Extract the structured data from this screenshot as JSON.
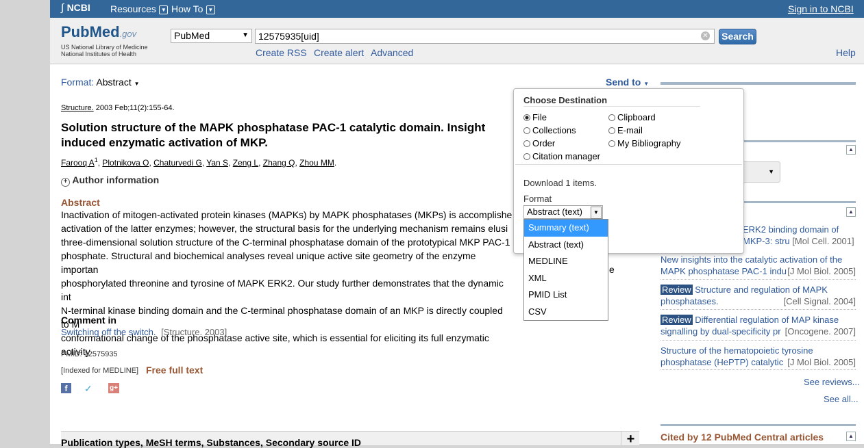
{
  "topbar": {
    "ncbi": "NCBI",
    "resources": "Resources",
    "howto": "How To",
    "signin": "Sign in to NCBI"
  },
  "header": {
    "logo_pub": "Pub",
    "logo_med": "Med",
    "logo_gov": ".gov",
    "logo_sub1": "US National Library of Medicine",
    "logo_sub2": "National Institutes of Health",
    "db_select": "PubMed",
    "search_value": "12575935[uid]",
    "search_button": "Search",
    "create_rss": "Create RSS",
    "create_alert": "Create alert",
    "advanced": "Advanced",
    "help": "Help"
  },
  "toolbar": {
    "format_label": "Format:",
    "format_value": "Abstract",
    "send_to": "Send to"
  },
  "article": {
    "journal": "Structure.",
    "citation": " 2003 Feb;11(2):155-64.",
    "title_line1": "Solution structure of the MAPK phosphatase PAC-1 catalytic domain. Insight",
    "title_line2": "induced enzymatic activation of MKP.",
    "authors": [
      "Farooq A",
      "Plotnikova O",
      "Chaturvedi G",
      "Yan S",
      "Zeng L",
      "Zhang Q",
      "Zhou MM"
    ],
    "author_sup": "1",
    "author_info": "Author information",
    "abstract_heading": "Abstract",
    "abstract_lines": [
      "Inactivation of mitogen-activated protein kinases (MAPKs) by MAPK phosphatases (MKPs) is accomplishe",
      "activation of the latter enzymes; however, the structural basis for the underlying mechanism remains elusi",
      "three-dimensional solution structure of the C-terminal phosphatase domain of the prototypical MKP PAC-1",
      "phosphate. Structural and biochemical analyses reveal unique active site geometry of the enzyme importan",
      "phosphorylated threonine and tyrosine of MAPK ERK2. Our study further demonstrates that the dynamic int",
      "N-terminal kinase binding domain and the C-terminal phosphatase domain of an MKP is directly coupled to M",
      "conformational change of the phosphatase active site, which is essential for eliciting its full enzymatic activity"
    ],
    "abstract_tail_5": "e",
    "comment_heading": "Comment in",
    "comment_link": "Switching off the switch.",
    "comment_src": "[Structure. 2003]",
    "pmid": "PMID: 12575935",
    "indexed": "[Indexed for MEDLINE]",
    "free_full_text": "Free full text",
    "bottom_bar": "Publication types, MeSH terms, Substances, Secondary source ID"
  },
  "send_popup": {
    "title": "Choose Destination",
    "options_left": [
      "File",
      "Collections",
      "Order",
      "Citation manager"
    ],
    "options_right": [
      "Clipboard",
      "E-mail",
      "My Bibliography"
    ],
    "selected": "File",
    "download": "Download 1 items.",
    "format_label": "Format",
    "format_value": "Abstract (text)",
    "format_options": [
      "Summary (text)",
      "Abstract (text)",
      "MEDLINE",
      "XML",
      "PMID List",
      "CSV"
    ],
    "highlighted_option": "Summary (text)"
  },
  "sidebar": {
    "partial1_line1": "ERK2 binding domain of",
    "partial1_line2": "MKP-3: stru",
    "partial1_src": "[Mol Cell. 2001]",
    "items": [
      {
        "badge": "",
        "line1": "New insights into the catalytic activation of the",
        "line2": "MAPK phosphatase PAC-1 indu",
        "src": "[J Mol Biol. 2005]"
      },
      {
        "badge": "Review",
        "line1": "Structure and regulation of MAPK",
        "line2": "phosphatases.",
        "src": "[Cell Signal. 2004]"
      },
      {
        "badge": "Review",
        "line1": "Differential regulation of MAP kinase",
        "line2": "signalling by dual-specificity pr",
        "src": "[Oncogene. 2007]"
      },
      {
        "badge": "",
        "line1": "Structure of the hematopoietic tyrosine",
        "line2": "phosphatase (HePTP) catalytic",
        "src": "[J Mol Biol. 2005]"
      }
    ],
    "see_reviews": "See reviews...",
    "see_all": "See all...",
    "cited_by": "Cited by 12 PubMed Central articles"
  },
  "colors": {
    "topbar": "#336699",
    "section": "#985735",
    "link": "#2f5a9c",
    "highlight": "#3399ff"
  }
}
